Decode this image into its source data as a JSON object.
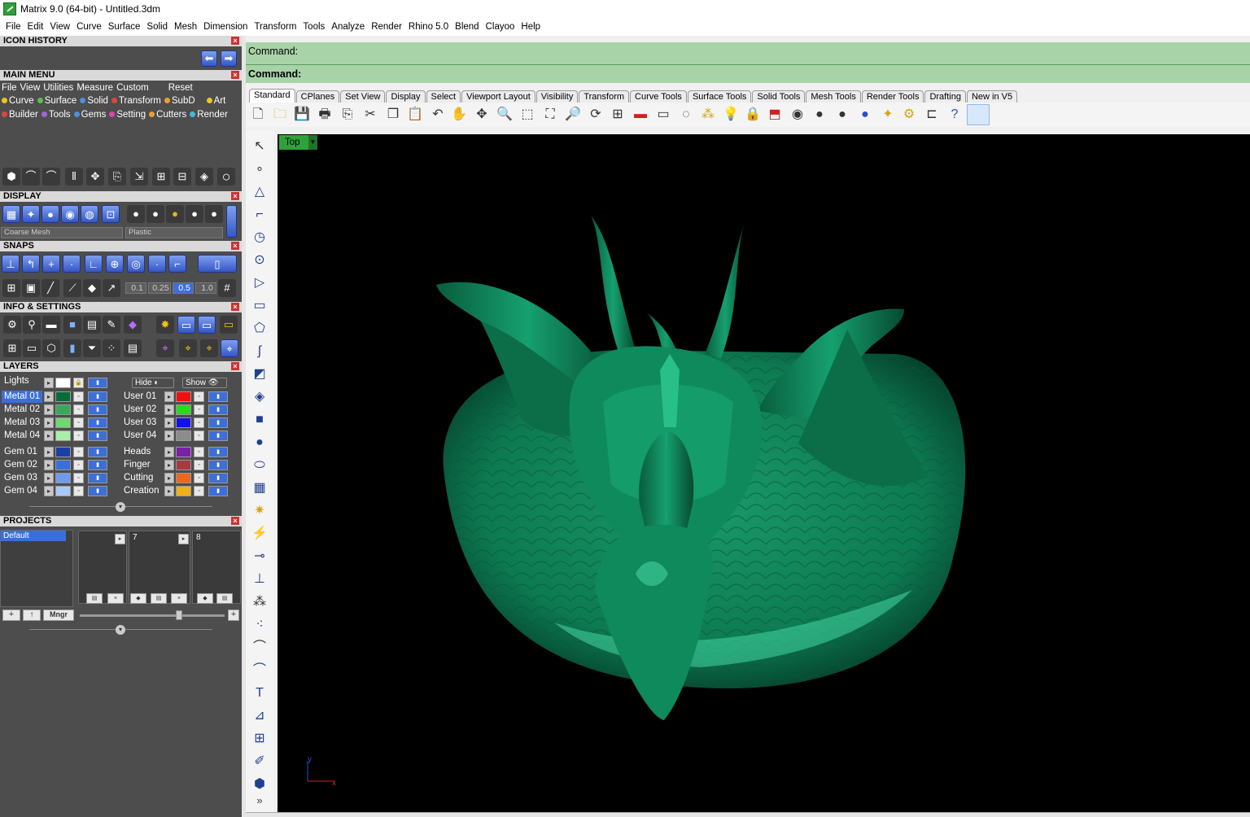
{
  "window": {
    "title": "Matrix 9.0 (64-bit) - Untitled.3dm"
  },
  "menubar": {
    "items": [
      "File",
      "Edit",
      "View",
      "Curve",
      "Surface",
      "Solid",
      "Mesh",
      "Dimension",
      "Transform",
      "Tools",
      "Analyze",
      "Render",
      "Rhino 5.0",
      "Blend",
      "Clayoo",
      "Help"
    ]
  },
  "left_panel": {
    "icon_history": {
      "title": "ICON HISTORY"
    },
    "main_menu": {
      "title": "MAIN MENU",
      "menu": [
        "File",
        "View",
        "Utilities",
        "Measure",
        "Custom"
      ],
      "reset": "Reset",
      "row1": [
        {
          "label": "Curve",
          "color": "#f0c419"
        },
        {
          "label": "Surface",
          "color": "#5bbf4b"
        },
        {
          "label": "Solid",
          "color": "#4a90e2"
        },
        {
          "label": "Transform",
          "color": "#e0443a"
        },
        {
          "label": "SubD",
          "color": "#f09d2e"
        },
        {
          "label": "Art",
          "color": "#f0c419"
        }
      ],
      "row2": [
        {
          "label": "Builder",
          "color": "#e0443a"
        },
        {
          "label": "Tools",
          "color": "#9a6ad6"
        },
        {
          "label": "Gems",
          "color": "#4a90e2"
        },
        {
          "label": "Setting",
          "color": "#d845b5"
        },
        {
          "label": "Cutters",
          "color": "#f09d2e"
        },
        {
          "label": "Render",
          "color": "#4ab8d6"
        }
      ]
    },
    "display": {
      "title": "DISPLAY",
      "mesh_mode": "Coarse Mesh",
      "material": "Plastic"
    },
    "snaps": {
      "title": "SNAPS",
      "values": [
        "0.1",
        "0.25",
        "0.5",
        "1.0"
      ]
    },
    "info": {
      "title": "INFO & SETTINGS"
    },
    "layers": {
      "title": "LAYERS",
      "lights": "Lights",
      "hide": "Hide",
      "show": "Show",
      "left": [
        {
          "name": "Metal 01",
          "color": "#0a6b3a"
        },
        {
          "name": "Metal 02",
          "color": "#3aa85a"
        },
        {
          "name": "Metal 03",
          "color": "#6fd86f"
        },
        {
          "name": "Metal 04",
          "color": "#a8f0a8"
        },
        {
          "name": "Gem 01",
          "color": "#1a3fa8"
        },
        {
          "name": "Gem 02",
          "color": "#3a6fd8"
        },
        {
          "name": "Gem 03",
          "color": "#6f9af0"
        },
        {
          "name": "Gem 04",
          "color": "#a8c8f8"
        }
      ],
      "right": [
        {
          "name": "User 01",
          "color": "#ee1111"
        },
        {
          "name": "User 02",
          "color": "#22dd22"
        },
        {
          "name": "User 03",
          "color": "#1111ee"
        },
        {
          "name": "User 04",
          "color": "#8c8c8c"
        },
        {
          "name": "Heads",
          "color": "#7a1fa8"
        },
        {
          "name": "Finger",
          "color": "#a83a3a"
        },
        {
          "name": "Cutting",
          "color": "#f0661a"
        },
        {
          "name": "Creation",
          "color": "#f0b01a"
        }
      ]
    },
    "projects": {
      "title": "PROJECTS",
      "selected": "Default",
      "slot_a": "7",
      "slot_b": "8",
      "manager": "Mngr"
    }
  },
  "command": {
    "line1": "Command:",
    "line2": "Command:"
  },
  "tabs": [
    "Standard",
    "CPlanes",
    "Set View",
    "Display",
    "Select",
    "Viewport Layout",
    "Visibility",
    "Transform",
    "Curve Tools",
    "Surface Tools",
    "Solid Tools",
    "Mesh Tools",
    "Render Tools",
    "Drafting",
    "New in V5"
  ],
  "viewport": {
    "name": "Top",
    "axis_x": "x",
    "axis_y": "y",
    "model_color": "#0e7a55"
  },
  "vertical_toolbar": {
    "more": "»"
  }
}
